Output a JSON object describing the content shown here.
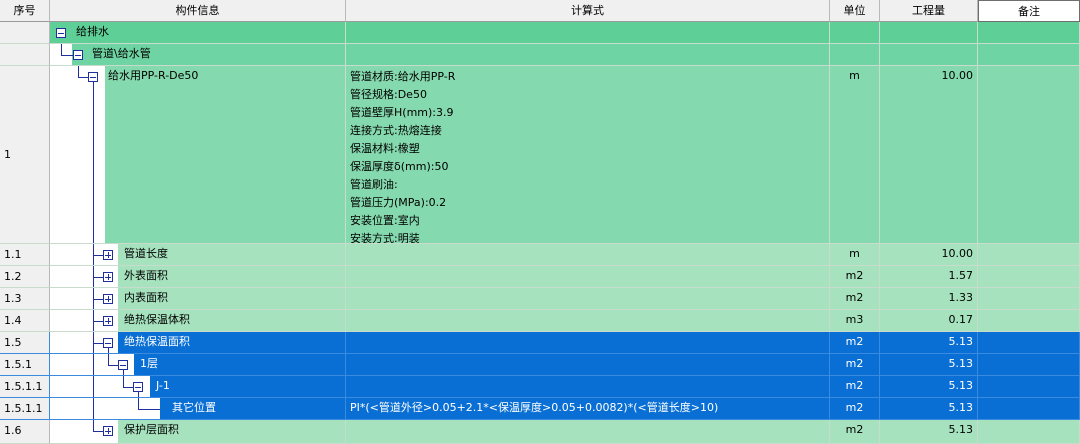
{
  "headers": {
    "seq": "序号",
    "info": "构件信息",
    "formula": "计算式",
    "unit": "单位",
    "qty": "工程量",
    "note": "备注"
  },
  "rows": [
    {
      "seq": "",
      "label": "给排水",
      "formula": "",
      "unit": "",
      "qty": ""
    },
    {
      "seq": "",
      "label": "管道\\给水管",
      "formula": "",
      "unit": "",
      "qty": ""
    },
    {
      "seq": "1",
      "label": "给水用PP-R-De50",
      "formula_lines": [
        "管道材质:给水用PP-R",
        "管径规格:De50",
        "管道壁厚H(mm):3.9",
        "连接方式:热熔连接",
        "保温材料:橡塑",
        "保温厚度δ(mm):50",
        "管道刷油:",
        "管道压力(MPa):0.2",
        "安装位置:室内",
        "安装方式:明装"
      ],
      "unit": "m",
      "qty": "10.00"
    },
    {
      "seq": "1.1",
      "label": "管道长度",
      "formula": "",
      "unit": "m",
      "qty": "10.00"
    },
    {
      "seq": "1.2",
      "label": "外表面积",
      "formula": "",
      "unit": "m2",
      "qty": "1.57"
    },
    {
      "seq": "1.3",
      "label": "内表面积",
      "formula": "",
      "unit": "m2",
      "qty": "1.33"
    },
    {
      "seq": "1.4",
      "label": "绝热保温体积",
      "formula": "",
      "unit": "m3",
      "qty": "0.17"
    },
    {
      "seq": "1.5",
      "label": "绝热保温面积",
      "formula": "",
      "unit": "m2",
      "qty": "5.13"
    },
    {
      "seq": "1.5.1",
      "label": "1层",
      "formula": "",
      "unit": "m2",
      "qty": "5.13"
    },
    {
      "seq": "1.5.1.1",
      "label": "J-1",
      "formula": "",
      "unit": "m2",
      "qty": "5.13"
    },
    {
      "seq": "1.5.1.1",
      "label": "其它位置",
      "formula": "PI*(<管道外径>0.05+2.1*<保温厚度>0.05+0.0082)*(<管道长度>10)",
      "unit": "m2",
      "qty": "5.13"
    },
    {
      "seq": "1.6",
      "label": "保护层面积",
      "formula": "",
      "unit": "m2",
      "qty": "5.13"
    }
  ],
  "colors": {
    "level0": "#5fcf98",
    "level1": "#6fd4a3",
    "level2": "#85d9ae",
    "child": "#a7e2bf",
    "selected": "#0a6fd4"
  }
}
